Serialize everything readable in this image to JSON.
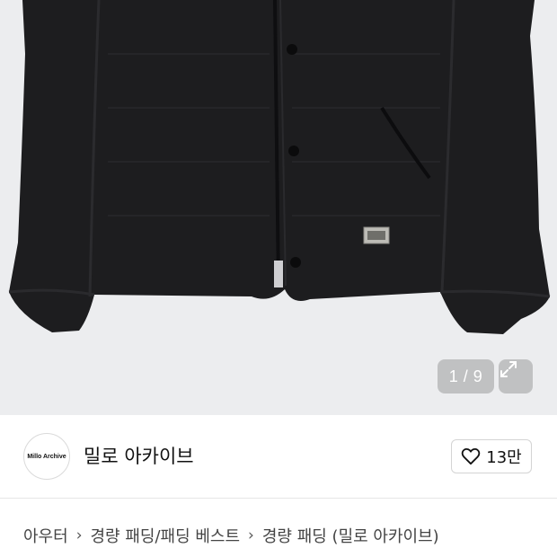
{
  "product_image": {
    "alt": "black quilted jacket",
    "counter": "1 / 9"
  },
  "brand": {
    "logo_text": "Millo Archive",
    "name": "밀로 아카이브"
  },
  "like": {
    "count": "13만"
  },
  "breadcrumb": [
    {
      "label": "아우터"
    },
    {
      "label": "경량 패딩/패딩 베스트"
    },
    {
      "label": "경량 패딩 (밀로 아카이브)"
    }
  ],
  "colors": {
    "image_background": "#ecedef",
    "jacket": "#1c1c1e",
    "text": "#111111",
    "breadcrumb_text": "#444444"
  }
}
